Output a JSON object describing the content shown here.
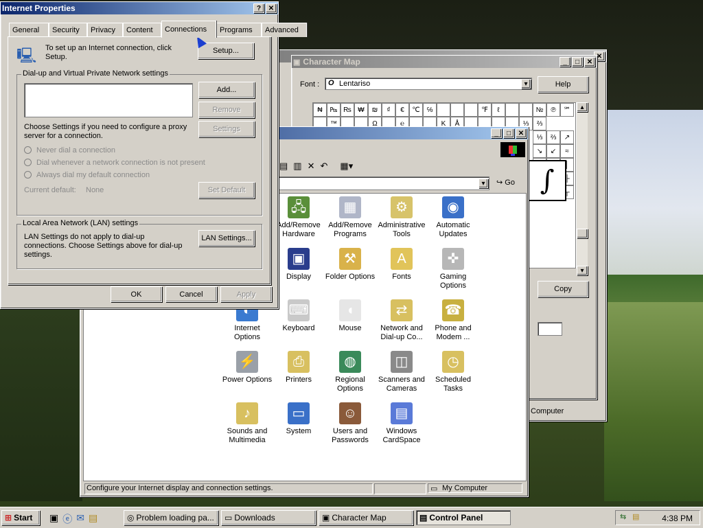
{
  "internet_properties": {
    "title": "Internet Properties",
    "tabs": [
      "General",
      "Security",
      "Privacy",
      "Content",
      "Connections",
      "Programs",
      "Advanced"
    ],
    "selected_tab": "Connections",
    "setup_text": "To set up an Internet connection, click Setup.",
    "setup_button": "Setup...",
    "dialup_group": "Dial-up and Virtual Private Network settings",
    "add_button": "Add...",
    "remove_button": "Remove",
    "settings_button": "Settings",
    "proxy_text": "Choose Settings if you need to configure a proxy server for a connection.",
    "radio_never": "Never dial a connection",
    "radio_whenever": "Dial whenever a network connection is not present",
    "radio_always": "Always dial my default connection",
    "current_default_label": "Current default:",
    "current_default_value": "None",
    "set_default_button": "Set Default",
    "lan_group": "Local Area Network (LAN) settings",
    "lan_text": "LAN Settings do not apply to dial-up connections. Choose Settings above for dial-up settings.",
    "lan_button": "LAN Settings...",
    "ok": "OK",
    "cancel": "Cancel",
    "apply": "Apply"
  },
  "character_map": {
    "title": "Character Map",
    "font_label": "Font :",
    "font_value": "Lentariso",
    "help_button": "Help",
    "copy_button": "Copy",
    "row1": [
      "₦",
      "₧",
      "₨",
      "₩",
      "₪",
      "₫",
      "€",
      "℃",
      "℅",
      "",
      "",
      "",
      "℉",
      "ℓ",
      "",
      "",
      "№",
      "℗",
      "℠"
    ],
    "row2": [
      "",
      "™",
      "",
      "",
      "Ω",
      "",
      "℮",
      "",
      "",
      "K",
      "Å",
      "",
      "",
      "",
      "",
      "⅓",
      "⅔"
    ],
    "right_glyphs": [
      "⅓",
      "⅔",
      "↗",
      "↘",
      "↙",
      "≈",
      "⟨",
      "⟩",
      "│",
      "║",
      "┘",
      "├",
      "┬",
      "┬",
      "┬"
    ],
    "zoom_glyph": "∫",
    "status": "Computer"
  },
  "control_panel": {
    "go_label": "Go",
    "status_text": "Configure your Internet display and connection settings.",
    "status_right": "My Computer",
    "icons": [
      {
        "label": "Add/Remove Hardware",
        "glyph": "🖧",
        "color": "#5a8f3a"
      },
      {
        "label": "Add/Remove Programs",
        "glyph": "▦",
        "color": "#b0b6c8"
      },
      {
        "label": "Administrative Tools",
        "glyph": "⚙",
        "color": "#d7c36a"
      },
      {
        "label": "Automatic Updates",
        "glyph": "◉",
        "color": "#3a70c8"
      },
      {
        "label": "Display",
        "glyph": "▣",
        "color": "#2a3d8c"
      },
      {
        "label": "Folder Options",
        "glyph": "⚒",
        "color": "#d9b24a"
      },
      {
        "label": "Fonts",
        "glyph": "A",
        "color": "#e1c45a"
      },
      {
        "label": "Gaming Options",
        "glyph": "✜",
        "color": "#b7b7b7"
      },
      {
        "label": "Internet Options",
        "glyph": "◐",
        "color": "#3a7ad0"
      },
      {
        "label": "Keyboard",
        "glyph": "⌨",
        "color": "#c9c9c9"
      },
      {
        "label": "Mouse",
        "glyph": "◖",
        "color": "#e6e6e6"
      },
      {
        "label": "Network and Dial-up Co...",
        "glyph": "⇄",
        "color": "#d8c060"
      },
      {
        "label": "Phone and Modem ...",
        "glyph": "☎",
        "color": "#c8b040"
      },
      {
        "label": "Power Options",
        "glyph": "⚡",
        "color": "#9aa0a8"
      },
      {
        "label": "Printers",
        "glyph": "⎙",
        "color": "#d8c060"
      },
      {
        "label": "Regional Options",
        "glyph": "◍",
        "color": "#3a8a5a"
      },
      {
        "label": "Scanners and Cameras",
        "glyph": "◫",
        "color": "#8a8a8a"
      },
      {
        "label": "Scheduled Tasks",
        "glyph": "◷",
        "color": "#d8c060"
      },
      {
        "label": "Sounds and Multimedia",
        "glyph": "♪",
        "color": "#d8c060"
      },
      {
        "label": "System",
        "glyph": "▭",
        "color": "#3a70c8"
      },
      {
        "label": "Users and Passwords",
        "glyph": "☺",
        "color": "#8a5a3a"
      },
      {
        "label": "Windows CardSpace",
        "glyph": "▤",
        "color": "#5a7ad8"
      }
    ]
  },
  "taskbar": {
    "start": "Start",
    "items": [
      "Problem loading pa...",
      "Downloads",
      "Character Map",
      "Control Panel"
    ],
    "active_item": "Control Panel",
    "clock": "4:38 PM"
  },
  "colors": {
    "title_active": "#0a246a",
    "title_inactive": "#808080",
    "face": "#d4d0c8"
  }
}
